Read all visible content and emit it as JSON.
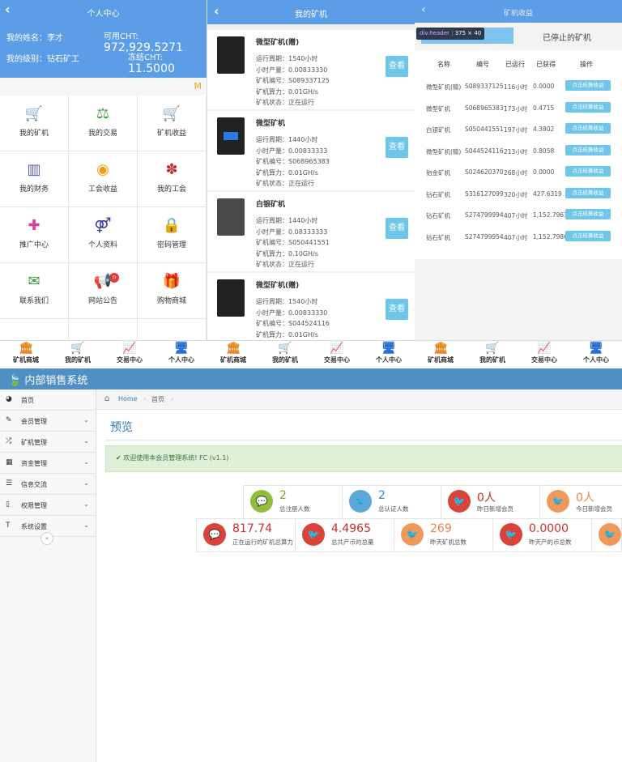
{
  "panel1": {
    "title": "个人中心",
    "back_icon": "‹",
    "name_label": "我的姓名：李才",
    "level_label": "我的级别：钻石矿工",
    "available_label": "可用CHT:",
    "available_value": "972,929.5271",
    "frozen_label": "冻结CHT:",
    "frozen_value": "11.5000",
    "notice_icon": "M",
    "grid": [
      {
        "label": "我的矿机",
        "icon": "cart-icon",
        "glyph": "🛒",
        "color": "#3a3a9a"
      },
      {
        "label": "我的交易",
        "icon": "scale-icon",
        "glyph": "⚖",
        "color": "#3c9a3c"
      },
      {
        "label": "矿机收益",
        "icon": "cart-plus-icon",
        "glyph": "🛒",
        "color": "#d9342b"
      },
      {
        "label": "我的财务",
        "icon": "bar-chart-icon",
        "glyph": "▥",
        "color": "#5a5ab0"
      },
      {
        "label": "工会收益",
        "icon": "coin-icon",
        "glyph": "◉",
        "color": "#f29b16"
      },
      {
        "label": "我的工会",
        "icon": "group-icon",
        "glyph": "✽",
        "color": "#c02f2f"
      },
      {
        "label": "推广中心",
        "icon": "user-plus-icon",
        "glyph": "✚",
        "color": "#d93ca7"
      },
      {
        "label": "个人资料",
        "icon": "gender-icon",
        "glyph": "⚤",
        "color": "#3a3a9a"
      },
      {
        "label": "密码管理",
        "icon": "lock-icon",
        "glyph": "🔒",
        "color": "#3a5dd0"
      },
      {
        "label": "联系我们",
        "icon": "envelope-icon",
        "glyph": "✉",
        "color": "#2f9a3c"
      },
      {
        "label": "网站公告",
        "icon": "megaphone-icon",
        "glyph": "📢",
        "color": "#e04a3a",
        "badge": "0"
      },
      {
        "label": "购物商城",
        "icon": "gift-icon",
        "glyph": "🎁",
        "color": "#2f8a2f"
      }
    ]
  },
  "panel2": {
    "title": "我的矿机",
    "back_icon": "‹",
    "view_label": "查看",
    "miners": [
      {
        "name": "微型矿机(赠)",
        "cycle": "运行周期：1540小时",
        "hourly": "小时产量：0.00833330",
        "serial": "矿机编号：S089337125",
        "power": "矿机算力：0.01GH/s",
        "status": "矿机状态：正在运行",
        "style": "dark"
      },
      {
        "name": "微型矿机",
        "cycle": "运行周期：1440小时",
        "hourly": "小时产量：0.00833333",
        "serial": "矿机编号：S068965383",
        "power": "矿机算力：0.01GH/s",
        "status": "矿机状态：正在运行",
        "style": "blue"
      },
      {
        "name": "白银矿机",
        "cycle": "运行周期：1440小时",
        "hourly": "小时产量：0.08333333",
        "serial": "矿机编号：S050441551",
        "power": "矿机算力：0.10GH/s",
        "status": "矿机状态：正在运行",
        "style": "silver"
      },
      {
        "name": "微型矿机(赠)",
        "cycle": "运行周期：1540小时",
        "hourly": "小时产量：0.00833330",
        "serial": "矿机编号：S044524116",
        "power": "矿机算力：0.01GH/s",
        "status": "",
        "style": "dark"
      }
    ]
  },
  "panel3": {
    "title": "矿机收益",
    "back_icon": "‹",
    "tooltip_tag": "div.header",
    "tooltip_size": "375 × 40",
    "stopped_tab": "已停止的矿机",
    "columns": [
      "名称",
      "编号",
      "已运行",
      "已获得",
      "操作"
    ],
    "action_label": "点击结算收益",
    "rows": [
      {
        "name": "微型矿机(赠)",
        "serial": "S089337125",
        "hours": "116小时",
        "earned": "0.0000"
      },
      {
        "name": "微型矿机",
        "serial": "S068965383",
        "hours": "173小时",
        "earned": "0.4715"
      },
      {
        "name": "白银矿机",
        "serial": "S050441551",
        "hours": "197小时",
        "earned": "4.3802"
      },
      {
        "name": "微型矿机(赠)",
        "serial": "S044524116",
        "hours": "213小时",
        "earned": "0.8058"
      },
      {
        "name": "铂金矿机",
        "serial": "S024620370",
        "hours": "268小时",
        "earned": "0.0000"
      },
      {
        "name": "钻石矿机",
        "serial": "S316127099",
        "hours": "320小时",
        "earned": "427.6319"
      },
      {
        "name": "钻石矿机",
        "serial": "S274799994",
        "hours": "407小时",
        "earned": "1,152.7963"
      },
      {
        "name": "钻石矿机",
        "serial": "S274799954",
        "hours": "407小时",
        "earned": "1,152.7986"
      }
    ]
  },
  "bottom_nav": [
    {
      "label": "矿机商城",
      "icon": "bank-icon",
      "glyph": "🏛",
      "color": "#e08a1e"
    },
    {
      "label": "我的矿机",
      "icon": "cart-icon",
      "glyph": "🛒",
      "color": "#3a3a9a"
    },
    {
      "label": "交易中心",
      "icon": "trend-icon",
      "glyph": "📈",
      "color": "#2f8a2f"
    },
    {
      "label": "个人中心",
      "icon": "monitor-icon",
      "glyph": "🖥",
      "color": "#2a6fd0"
    }
  ],
  "admin": {
    "system_title": "内部销售系统",
    "menu": [
      {
        "label": "首页",
        "icon": "dashboard-icon",
        "glyph": "◕",
        "chevron": false
      },
      {
        "label": "会员管理",
        "icon": "edit-icon",
        "glyph": "✎",
        "chevron": true
      },
      {
        "label": "矿机管理",
        "icon": "shuffle-icon",
        "glyph": "⤮",
        "chevron": true
      },
      {
        "label": "资金管理",
        "icon": "calendar-icon",
        "glyph": "▦",
        "chevron": true
      },
      {
        "label": "信息交流",
        "icon": "list-icon",
        "glyph": "☰",
        "chevron": true
      },
      {
        "label": "权限管理",
        "icon": "file-icon",
        "glyph": "▯",
        "chevron": true
      },
      {
        "label": "系统设置",
        "icon": "text-icon",
        "glyph": "T",
        "chevron": true
      }
    ],
    "breadcrumb_home": "Home",
    "breadcrumb_current": "首页",
    "page_title": "预览",
    "welcome": "✔ 欢迎使用本会员管理系统! FC (v1.1)",
    "stats_row1": [
      {
        "value": "2",
        "caption": "总注册人数",
        "icon": "comment-icon",
        "glyph": "💬",
        "color": "#8fbf3a",
        "numcolor": "#7aa830"
      },
      {
        "value": "2",
        "caption": "总认证人数",
        "icon": "twitter-icon",
        "glyph": "🐦",
        "color": "#5aa7d8",
        "numcolor": "#3b8ac8"
      },
      {
        "value": "0人",
        "caption": "昨日新增会员",
        "icon": "twitter-icon",
        "glyph": "🐦",
        "color": "#d9443a",
        "numcolor": "#c9302c"
      },
      {
        "value": "0人",
        "caption": "今日新增会员",
        "icon": "twitter-icon",
        "glyph": "🐦",
        "color": "#f09a5a",
        "numcolor": "#e8864a"
      }
    ],
    "stats_row2": [
      {
        "value": "817.74",
        "caption": "正在运行的矿机总算力",
        "icon": "comment-icon",
        "glyph": "💬",
        "color": "#d9443a",
        "numcolor": "#c9302c"
      },
      {
        "value": "4.4965",
        "caption": "总共产币的总量",
        "icon": "twitter-icon",
        "glyph": "🐦",
        "color": "#d9443a",
        "numcolor": "#c9302c"
      },
      {
        "value": "269",
        "caption": "昨天矿机总数",
        "icon": "twitter-icon",
        "glyph": "🐦",
        "color": "#f09a5a",
        "numcolor": "#e8864a"
      },
      {
        "value": "0.0000",
        "caption": "昨天产的币总数",
        "icon": "twitter-icon",
        "glyph": "🐦",
        "color": "#d9443a",
        "numcolor": "#c9302c"
      },
      {
        "value": "",
        "caption": "",
        "icon": "twitter-icon",
        "glyph": "🐦",
        "color": "#f09a5a",
        "numcolor": "#e8864a"
      }
    ]
  }
}
